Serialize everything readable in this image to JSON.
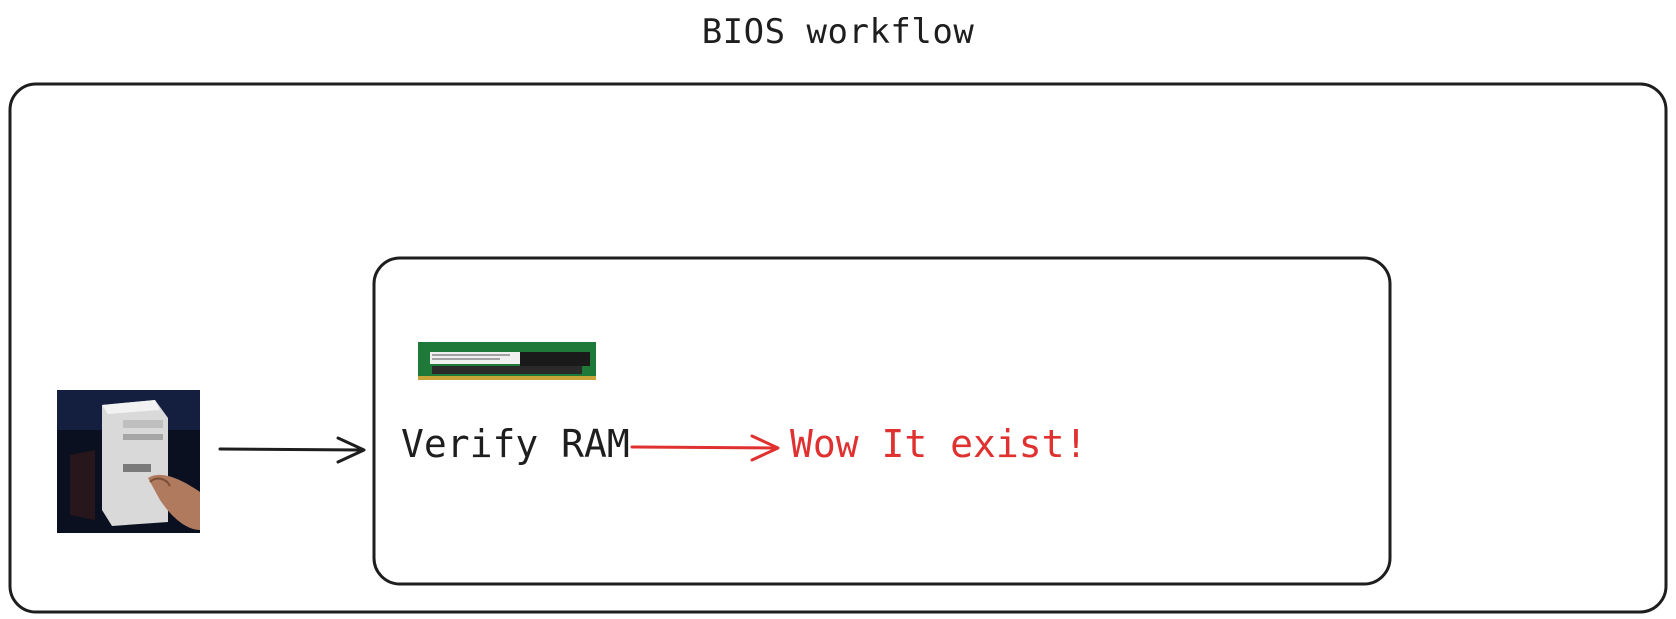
{
  "diagram": {
    "title": "BIOS workflow",
    "steps": {
      "verify_label": "Verify RAM",
      "result_label": "Wow It exist!"
    },
    "images": {
      "computer": "computer-tower-power-button-photo",
      "ram": "ram-memory-module-photo"
    },
    "colors": {
      "stroke": "#1e1e1e",
      "accent": "#e03131",
      "ram_pcb": "#1f7a3a"
    }
  }
}
